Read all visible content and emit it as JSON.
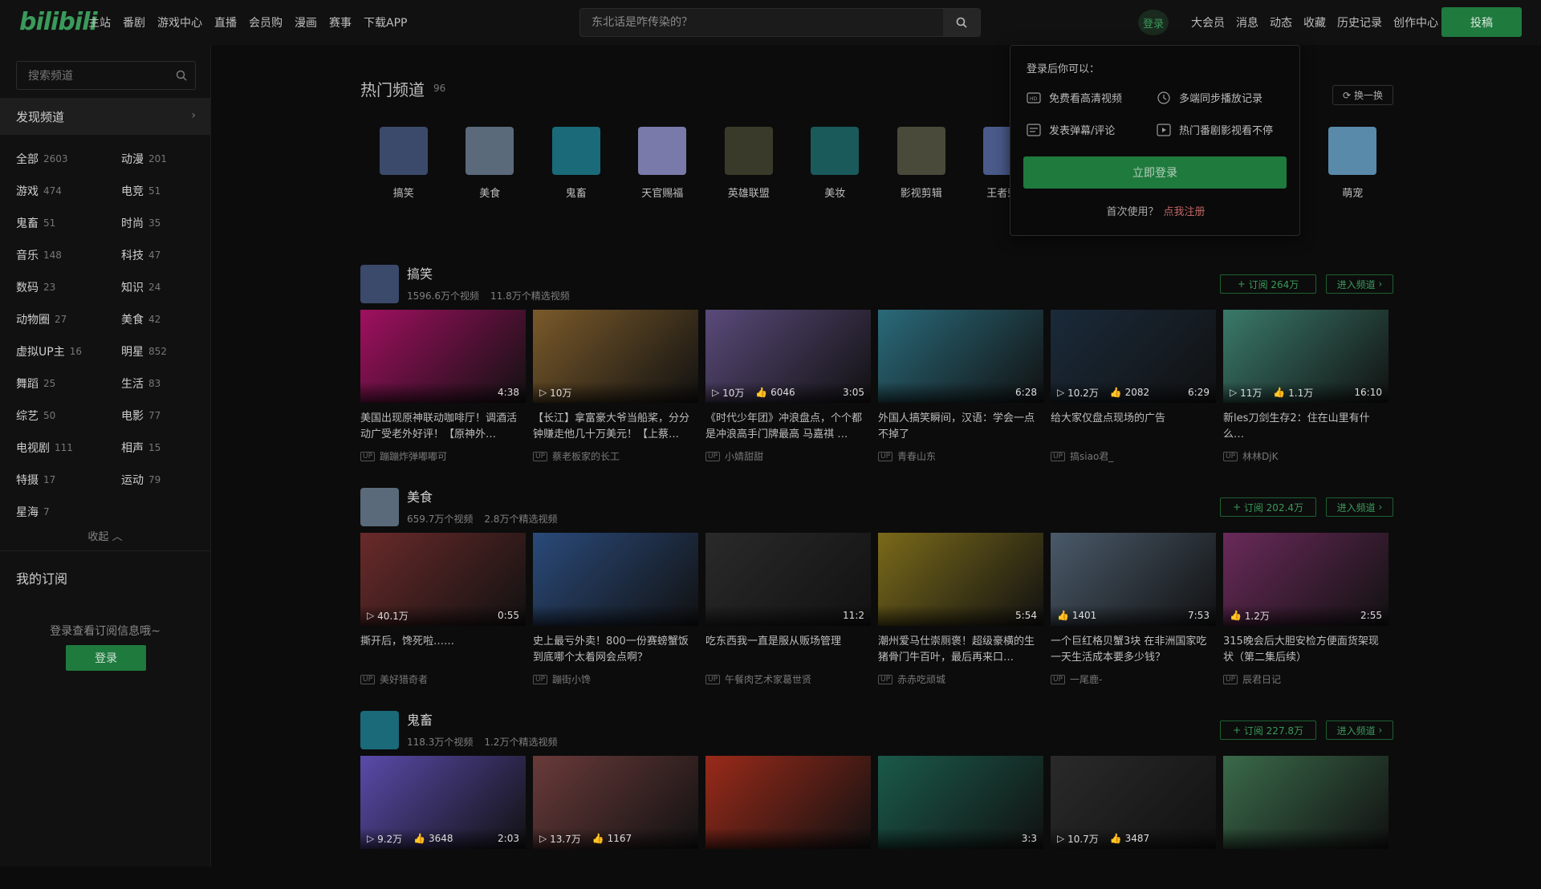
{
  "header": {
    "logo": "bilibili",
    "nav": [
      "主站",
      "番剧",
      "游戏中心",
      "直播",
      "会员购",
      "漫画",
      "赛事",
      "下载APP"
    ],
    "search_placeholder": "东北话是咋传染的？",
    "login": "登录",
    "right_nav": [
      "大会员",
      "消息",
      "动态",
      "收藏",
      "历史记录",
      "创作中心"
    ],
    "upload": "投稿"
  },
  "sidebar": {
    "search_placeholder": "搜索频道",
    "discover": "发现频道",
    "categories": [
      {
        "name": "全部",
        "count": "2603"
      },
      {
        "name": "动漫",
        "count": "201"
      },
      {
        "name": "游戏",
        "count": "474"
      },
      {
        "name": "电竞",
        "count": "51"
      },
      {
        "name": "鬼畜",
        "count": "51"
      },
      {
        "name": "时尚",
        "count": "35"
      },
      {
        "name": "音乐",
        "count": "148"
      },
      {
        "name": "科技",
        "count": "47"
      },
      {
        "name": "数码",
        "count": "23"
      },
      {
        "name": "知识",
        "count": "24"
      },
      {
        "name": "动物圈",
        "count": "27"
      },
      {
        "name": "美食",
        "count": "42"
      },
      {
        "name": "虚拟UP主",
        "count": "16"
      },
      {
        "name": "明星",
        "count": "852"
      },
      {
        "name": "舞蹈",
        "count": "25"
      },
      {
        "name": "生活",
        "count": "83"
      },
      {
        "name": "综艺",
        "count": "50"
      },
      {
        "name": "电影",
        "count": "77"
      },
      {
        "name": "电视剧",
        "count": "111"
      },
      {
        "name": "相声",
        "count": "15"
      },
      {
        "name": "特摄",
        "count": "17"
      },
      {
        "name": "运动",
        "count": "79"
      },
      {
        "name": "星海",
        "count": "7"
      }
    ],
    "collapse": "收起",
    "my_subs": "我的订阅",
    "sub_tip": "登录查看订阅信息哦~",
    "sub_login": "登录"
  },
  "hot": {
    "title": "热门频道",
    "count": "96",
    "refresh": "换一换",
    "channels": [
      {
        "name": "搞笑",
        "color": "#3b4a6a"
      },
      {
        "name": "美食",
        "color": "#5a6a7a"
      },
      {
        "name": "鬼畜",
        "color": "#1a6a7a"
      },
      {
        "name": "天官赐福",
        "color": "#7a7aaa"
      },
      {
        "name": "英雄联盟",
        "color": "#3a3a2a"
      },
      {
        "name": "美妆",
        "color": "#1a5a5a"
      },
      {
        "name": "影视剪辑",
        "color": "#4a4a3a"
      },
      {
        "name": "王者荣耀",
        "color": "#4a5a8a"
      },
      {
        "name": "",
        "color": "#000000"
      },
      {
        "name": "",
        "color": "#000000"
      },
      {
        "name": "",
        "color": "#000000"
      },
      {
        "name": "萌宠",
        "color": "#5a8aaa"
      }
    ]
  },
  "popup": {
    "title": "登录后你可以：",
    "items": [
      "免费看高清视频",
      "多端同步播放记录",
      "发表弹幕/评论",
      "热门番剧影视看不停"
    ],
    "button": "立即登录",
    "first_use": "首次使用？",
    "register": "点我注册"
  },
  "sections": [
    {
      "name": "搞笑",
      "videos_count": "1596.6万个视频",
      "featured_count": "11.8万个精选视频",
      "subscribe": "订阅 264万",
      "enter": "进入频道",
      "avatar_color": "#3b4a6a",
      "videos": [
        {
          "title": "美国出现原神联动咖啡厅！调酒活动广受老外好评！【原神外…",
          "up": "蹦蹦炸弹嘟嘟可",
          "views": "",
          "likes": "",
          "duration": "4:38",
          "color": "#a01060"
        },
        {
          "title": "【长江】拿富豪大爷当船桨，分分钟赚走他几十万美元！【上蔡…",
          "up": "蔡老板家的长工",
          "views": "10万",
          "likes": "",
          "duration": "",
          "color": "#7a5a2a"
        },
        {
          "title": "《时代少年团》冲浪盘点，个个都是冲浪高手门牌最高 马嘉祺 …",
          "up": "小婧甜甜",
          "views": "10万",
          "likes": "6046",
          "duration": "3:05",
          "color": "#5a4a7a"
        },
        {
          "title": "外国人搞笑瞬间，汉语：学会一点不掉了",
          "up": "青春山东",
          "views": "",
          "likes": "",
          "duration": "6:28",
          "color": "#2a6a7a"
        },
        {
          "title": "给大家仅盘点现场的广告",
          "up": "搞siao君_",
          "views": "10.2万",
          "likes": "2082",
          "duration": "6:29",
          "color": "#1a2a3a"
        },
        {
          "title": "新les刀剑生存2：住在山里有什么…",
          "up": "林林DjK",
          "views": "11万",
          "likes": "1.1万",
          "duration": "16:10",
          "color": "#3a7a6a"
        }
      ]
    },
    {
      "name": "美食",
      "videos_count": "659.7万个视频",
      "featured_count": "2.8万个精选视频",
      "subscribe": "订阅 202.4万",
      "enter": "进入频道",
      "avatar_color": "#5a6a7a",
      "videos": [
        {
          "title": "撕开后，馋死啦……",
          "up": "美好猎奇者",
          "views": "40.1万",
          "likes": "",
          "duration": "0:55",
          "color": "#6a2a2a"
        },
        {
          "title": "史上最亏外卖！800一份赛螃蟹饭到底哪个太着网会点啊？",
          "up": "蹦街小馋",
          "views": "",
          "likes": "",
          "duration": "",
          "color": "#2a4a7a"
        },
        {
          "title": "吃东西我一直是服从贩场管理",
          "up": "午餐肉艺术家葛世贤",
          "views": "",
          "likes": "",
          "duration": "11:2",
          "color": "#2a2a2a"
        },
        {
          "title": "潮州爱马仕崇厕褒！超级豪横的生猪骨门牛百叶，最后再来口…",
          "up": "赤赤吃顽城",
          "views": "",
          "likes": "",
          "duration": "5:54",
          "color": "#7a6a1a"
        },
        {
          "title": "一个巨红格贝蟹3块 在非洲国家吃一天生活成本要多少钱？",
          "up": "一尾鹿-",
          "views": "",
          "likes": "1401",
          "duration": "7:53",
          "color": "#4a5a6a"
        },
        {
          "title": "315晚会后大胆安检方便面货架现状（第二集后续）",
          "up": "辰君日记",
          "views": "",
          "likes": "1.2万",
          "duration": "2:55",
          "color": "#6a2a5a"
        }
      ]
    },
    {
      "name": "鬼畜",
      "videos_count": "118.3万个视频",
      "featured_count": "1.2万个精选视频",
      "subscribe": "订阅 227.8万",
      "enter": "进入频道",
      "avatar_color": "#1a6a7a",
      "videos": [
        {
          "title": "",
          "up": "",
          "views": "9.2万",
          "likes": "3648",
          "duration": "2:03",
          "color": "#5a4aaa"
        },
        {
          "title": "",
          "up": "",
          "views": "13.7万",
          "likes": "1167",
          "duration": "",
          "color": "#6a3a3a"
        },
        {
          "title": "",
          "up": "",
          "views": "",
          "likes": "",
          "duration": "",
          "color": "#9a2a1a"
        },
        {
          "title": "",
          "up": "",
          "views": "",
          "likes": "",
          "duration": "3:3",
          "color": "#1a5a4a"
        },
        {
          "title": "",
          "up": "",
          "views": "10.7万",
          "likes": "3487",
          "duration": "",
          "color": "#2a2a2a"
        },
        {
          "title": "",
          "up": "",
          "views": "",
          "likes": "",
          "duration": "",
          "color": "#3a6a4a"
        }
      ]
    }
  ]
}
